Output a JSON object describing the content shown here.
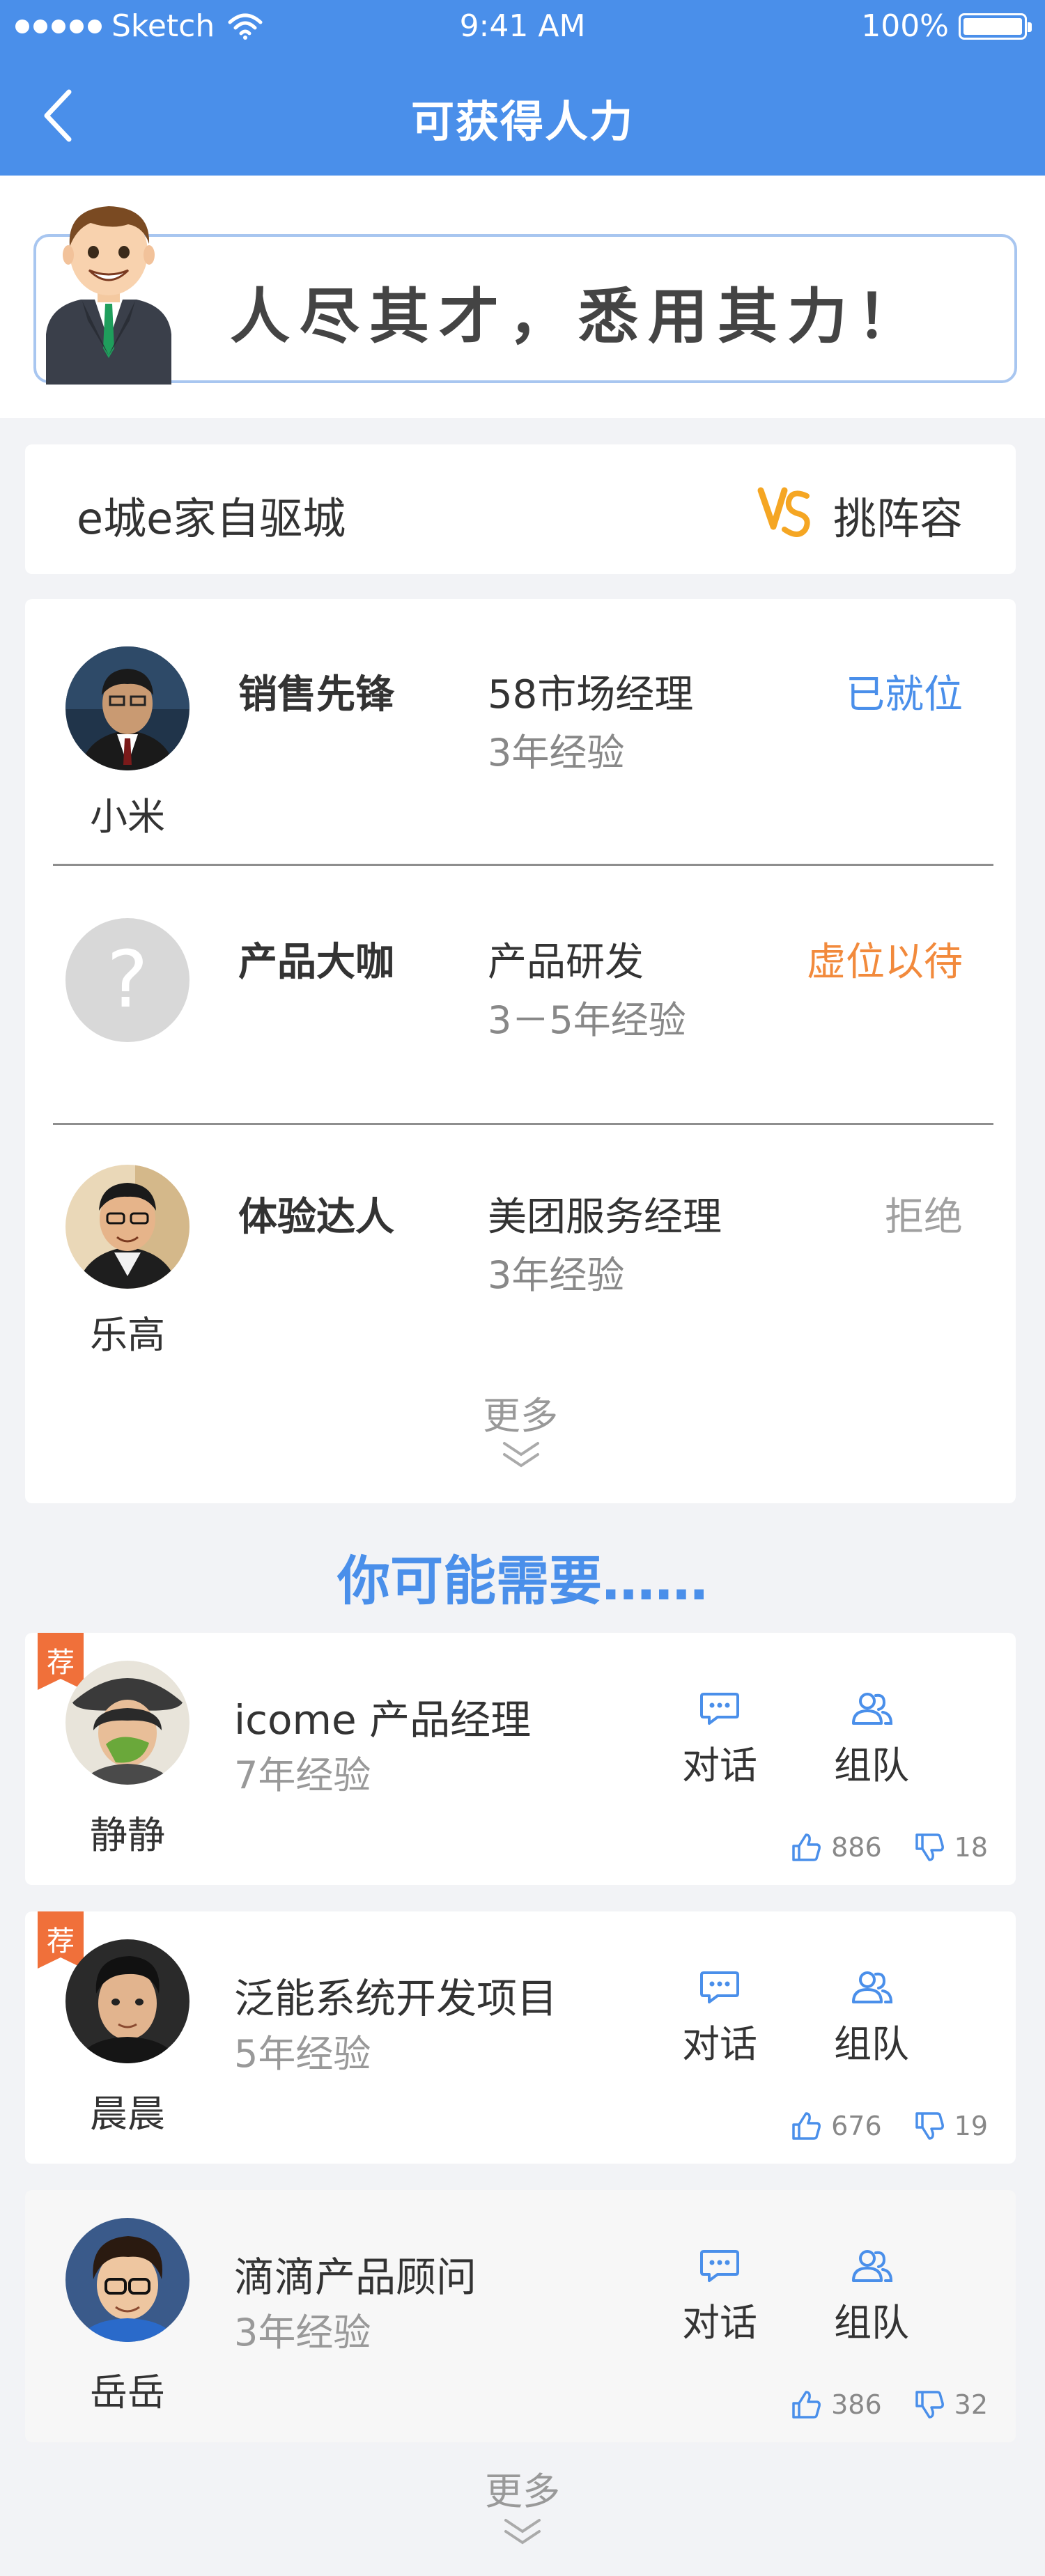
{
  "status_bar": {
    "carrier": "Sketch",
    "time": "9:41 AM",
    "battery": "100%"
  },
  "nav": {
    "title": "可获得人力"
  },
  "banner": {
    "slogan": "人尽其才，悉用其力！"
  },
  "team": {
    "name": "e城e家自驱城",
    "pick_label": "挑阵容"
  },
  "roster": {
    "members": [
      {
        "role": "销售先锋",
        "job": "58市场经理",
        "exp": "3年经验",
        "status": "已就位",
        "name": "小米"
      },
      {
        "role": "产品大咖",
        "job": "产品研发",
        "exp": "3－5年经验",
        "status": "虚位以待",
        "name": ""
      },
      {
        "role": "体验达人",
        "job": "美团服务经理",
        "exp": "3年经验",
        "status": "拒绝",
        "name": "乐高"
      }
    ],
    "more_label": "更多"
  },
  "recommend": {
    "title": "你可能需要……",
    "tag": "荐",
    "chat_label": "对话",
    "team_label": "组队",
    "items": [
      {
        "name": "静静",
        "job": "icome 产品经理",
        "exp": "7年经验",
        "likes": "886",
        "dislikes": "18"
      },
      {
        "name": "晨晨",
        "job": "泛能系统开发项目",
        "exp": "5年经验",
        "likes": "676",
        "dislikes": "19"
      },
      {
        "name": "岳岳",
        "job": "滴滴产品顾问",
        "exp": "3年经验",
        "likes": "386",
        "dislikes": "32"
      }
    ],
    "more_label": "更多"
  },
  "colors": {
    "primary": "#4A8FEA",
    "orange": "#F28A3C",
    "tag": "#F0703A"
  }
}
